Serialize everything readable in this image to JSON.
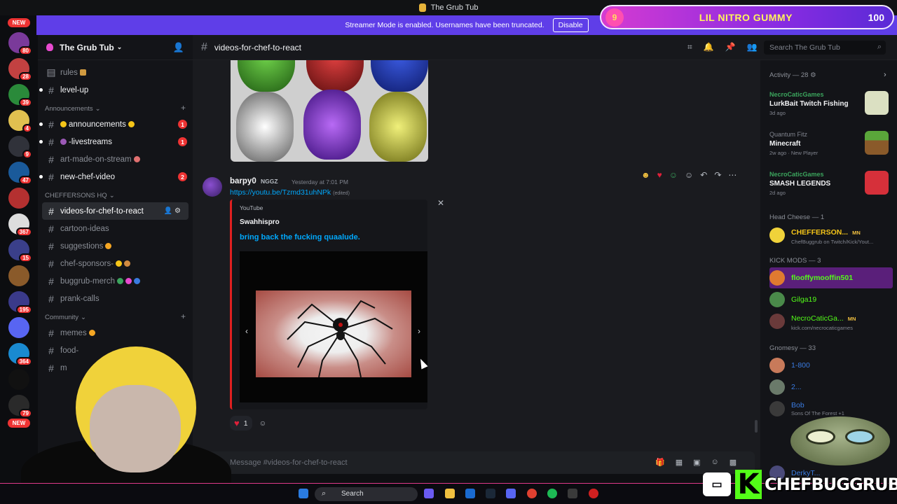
{
  "window_title": "The Grub Tub",
  "streamer_banner": {
    "text": "Streamer Mode is enabled. Usernames have been truncated.",
    "button": "Disable"
  },
  "nitro_overlay": {
    "level": "9",
    "name": "LIL NITRO GUMMY",
    "score": "100"
  },
  "guild_bar": {
    "new_top": "NEW",
    "new_bottom": "NEW",
    "badges": [
      "80",
      "28",
      "39",
      "4",
      "9",
      "47",
      "367",
      "15",
      "195",
      "364",
      "79"
    ]
  },
  "sidebar": {
    "server_name": "The Grub Tub",
    "channels_top": [
      {
        "name": "rules",
        "unread": false
      },
      {
        "name": "level-up",
        "unread": true
      }
    ],
    "categories": [
      {
        "name": "Announcements",
        "channels": [
          {
            "name": "announcements",
            "unread": true,
            "badge": "1"
          },
          {
            "name": "-livestreams",
            "unread": true,
            "badge": "1"
          },
          {
            "name": "art-made-on-stream",
            "unread": false,
            "badge": ""
          },
          {
            "name": "new-chef-video",
            "unread": true,
            "badge": "2"
          }
        ]
      },
      {
        "name": "CHEFFERSONS HQ",
        "channels": [
          {
            "name": "videos-for-chef-to-react",
            "unread": true,
            "badge": "",
            "active": true
          },
          {
            "name": "cartoon-ideas",
            "unread": false,
            "badge": ""
          },
          {
            "name": "suggestions",
            "unread": false,
            "badge": ""
          },
          {
            "name": "chef-sponsors-",
            "unread": false,
            "badge": ""
          },
          {
            "name": "buggrub-merch",
            "unread": false,
            "badge": ""
          },
          {
            "name": "prank-calls",
            "unread": false,
            "badge": ""
          }
        ]
      },
      {
        "name": "Community",
        "channels": [
          {
            "name": "memes",
            "unread": false,
            "badge": ""
          },
          {
            "name": "food-",
            "unread": false,
            "badge": ""
          },
          {
            "name": "m",
            "unread": false,
            "badge": ""
          }
        ]
      }
    ]
  },
  "header": {
    "channel": "videos-for-chef-to-react",
    "search_placeholder": "Search The Grub Tub"
  },
  "message": {
    "author": "barpy0",
    "tag": "NGGZ",
    "timestamp": "Yesterday at 7:01 PM",
    "link": "https://youtu.be/Tzmd31uhNPk",
    "edited": "(edited)",
    "embed": {
      "provider": "YouTube",
      "author": "Swahhispro",
      "title": "bring back the fucking quaalude."
    },
    "reaction_count": "1"
  },
  "composer": {
    "placeholder": "Message #videos-for-chef-to-react"
  },
  "members": {
    "activity_header": "Activity — 28",
    "activities": [
      {
        "user": "NecroCaticGames",
        "game": "LurkBait Twitch Fishing",
        "ago": "3d ago",
        "gray": false
      },
      {
        "user": "Quantum Fitz",
        "game": "Minecraft",
        "ago": "2w ago",
        "extra": "New Player",
        "gray": true
      },
      {
        "user": "NecroCaticGames",
        "game": "SMASH LEGENDS",
        "ago": "2d ago",
        "gray": false
      }
    ],
    "head_cheese_header": "Head Cheese — 1",
    "head_cheese": [
      {
        "name": "CHEFFERSON...",
        "sub": "ChefBuggrub on Twitch/Kick/Yout...",
        "tag": "MN"
      }
    ],
    "kick_mods_header": "KICK MODS — 3",
    "kick_mods": [
      {
        "name": "flooffymooffin501",
        "sub": ""
      },
      {
        "name": "Gilga19",
        "sub": ""
      },
      {
        "name": "NecroCaticGa...",
        "sub": "kick.com/necrocaticgames",
        "tag": "MN"
      }
    ],
    "gnomesy_header": "Gnomesy — 33",
    "gnomesy": [
      {
        "name": "1-800",
        "sub": ""
      },
      {
        "name": "2...",
        "sub": ""
      },
      {
        "name": "Bob",
        "sub": "Sons Of The Forest +1"
      },
      {
        "name": "DerkyT...",
        "sub": ""
      }
    ]
  },
  "taskbar": {
    "search": "Search"
  },
  "brand": {
    "name": "CHEFBUGGRUB"
  },
  "colors": {
    "accent": "#5f3ee8",
    "unread_badge": "#e33333",
    "link": "#00a8fc",
    "online": "#3ba55d",
    "embed_bar": "#e02020"
  }
}
